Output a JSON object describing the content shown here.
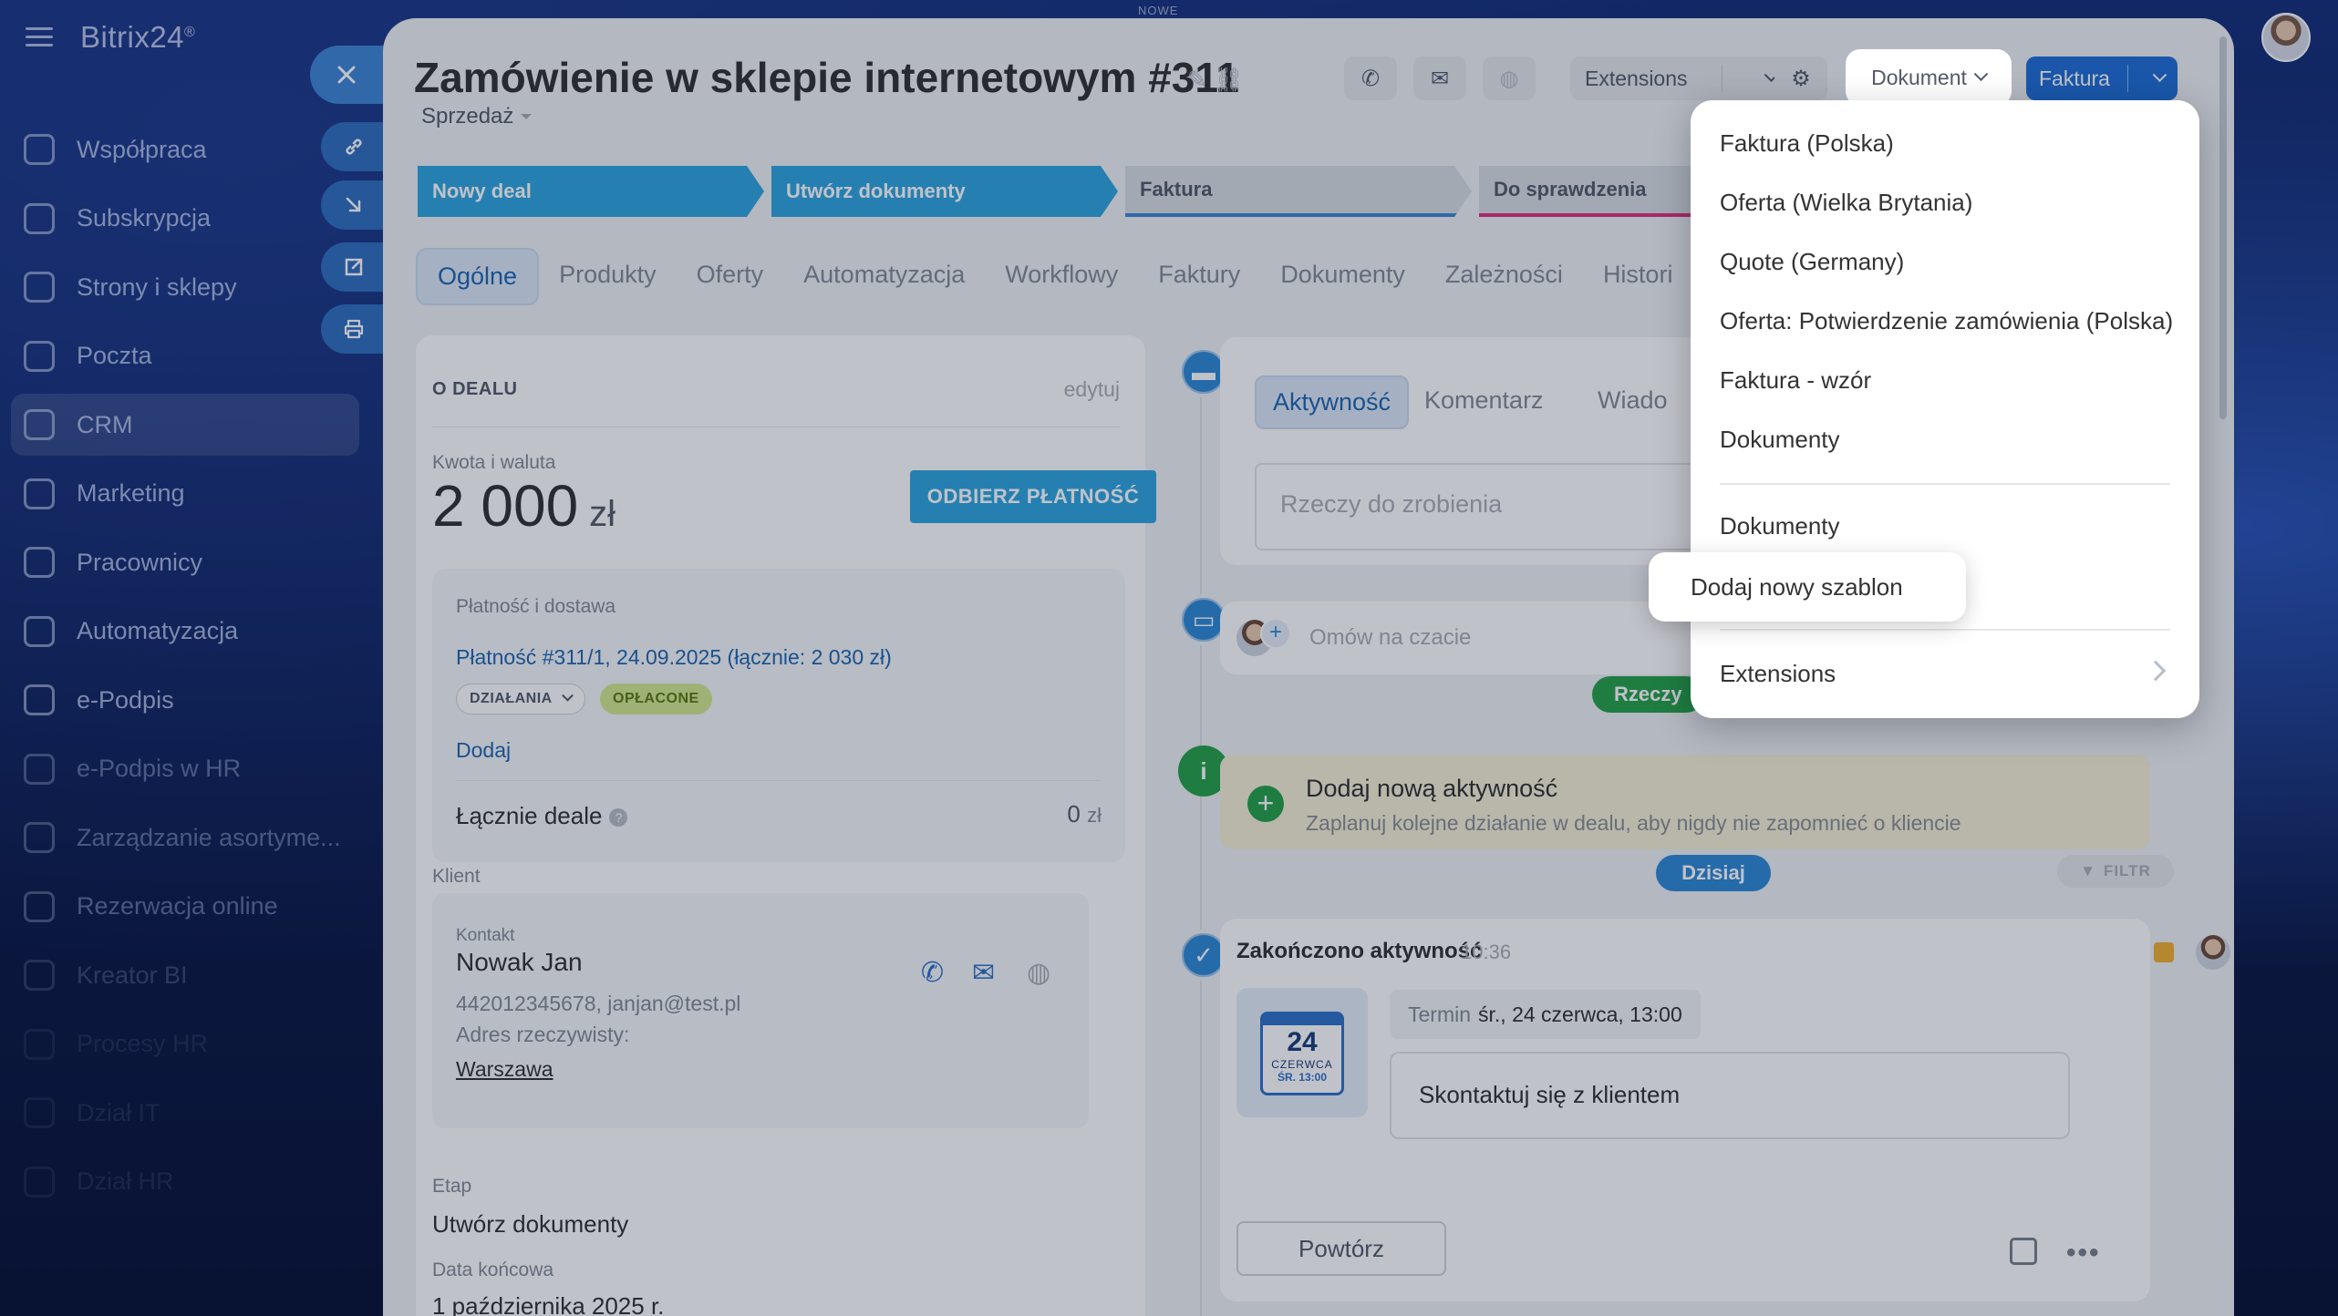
{
  "app": {
    "brand": "Bitrix24",
    "brand_mark": "®",
    "top_tag": "NOWE"
  },
  "sidebar": {
    "items": [
      {
        "label": "Współpraca",
        "icon": "chat-icon"
      },
      {
        "label": "Subskrypcja",
        "icon": "subscription-icon"
      },
      {
        "label": "Strony i sklepy",
        "icon": "cart-icon"
      },
      {
        "label": "Poczta",
        "icon": "mail-icon"
      },
      {
        "label": "CRM",
        "icon": "crm-icon",
        "active": true
      },
      {
        "label": "Marketing",
        "icon": "marketing-icon"
      },
      {
        "label": "Pracownicy",
        "icon": "employees-icon"
      },
      {
        "label": "Automatyzacja",
        "icon": "automation-icon"
      },
      {
        "label": "e-Podpis",
        "icon": "signature-icon"
      },
      {
        "label": "e-Podpis w HR",
        "icon": "hr-signature-icon"
      },
      {
        "label": "Zarządzanie asortyme...",
        "icon": "inventory-icon"
      },
      {
        "label": "Rezerwacja online",
        "icon": "booking-icon"
      },
      {
        "label": "Kreator BI",
        "icon": "bi-icon"
      },
      {
        "label": "Procesy HR",
        "icon": "hr-process-icon"
      },
      {
        "label": "Dział IT",
        "icon": "it-icon"
      },
      {
        "label": "Dział HR",
        "icon": "hr-icon"
      }
    ]
  },
  "header": {
    "title": "Zamówienie w sklepie internetowym #311",
    "pipeline": "Sprzedaż",
    "extensions_label": "Extensions",
    "document_label": "Dokument",
    "invoice_label": "Faktura"
  },
  "stages": [
    {
      "label": "Nowy deal",
      "state": "done"
    },
    {
      "label": "Utwórz dokumenty",
      "state": "done"
    },
    {
      "label": "Faktura",
      "state": "todo"
    },
    {
      "label": "Do sprawdzenia",
      "state": "todo"
    }
  ],
  "tabs": [
    "Ogólne",
    "Produkty",
    "Oferty",
    "Automatyzacja",
    "Workflowy",
    "Faktury",
    "Dokumenty",
    "Zależności",
    "Histori"
  ],
  "deal": {
    "section_title": "O DEALU",
    "edit": "edytuj",
    "amount_label": "Kwota i waluta",
    "amount": "2 000",
    "currency": "zł",
    "pay_button": "ODBIERZ PŁATNOŚĆ",
    "payment_section": "Płatność i dostawa",
    "payment_link": "Płatność #311/1, 24.09.2025 (łącznie: 2 030 zł)",
    "actions_chip": "DZIAŁANIA",
    "paid_chip": "OPŁACONE",
    "add_link": "Dodaj",
    "total_deals_label": "Łącznie deale",
    "total_deals_value": "0",
    "total_deals_currency": "zł",
    "client_label": "Klient",
    "contact_label": "Kontakt",
    "contact_name": "Nowak Jan",
    "contact_details": "442012345678, janjan@test.pl",
    "address_label": "Adres rzeczywisty:",
    "address_city": "Warszawa",
    "stage_label": "Etap",
    "stage_value": "Utwórz dokumenty",
    "end_date_label": "Data końcowa",
    "end_date_value": "1 października 2025 r."
  },
  "activity": {
    "tabs": [
      "Aktywność",
      "Komentarz",
      "Wiado"
    ],
    "todo_placeholder": "Rzeczy do zrobienia",
    "chat_placeholder": "Omów na czacie",
    "todo_pill": "Rzeczy",
    "hint_title": "Dodaj nową aktywność",
    "hint_subtitle": "Zaplanuj kolejne działanie w dealu, aby nigdy nie zapomnieć o kliencie",
    "today": "Dzisiaj",
    "filter": "FILTR",
    "done_title": "Zakończono aktywność",
    "done_time": "10:36",
    "calendar_day": "24",
    "calendar_month": "CZERWCA",
    "calendar_weekday": "ŚR. 13:00",
    "term_label": "Termin",
    "term_value": "śr., 24 czerwca, 13:00",
    "task_text": "Skontaktuj się z klientem",
    "repeat_button": "Powtórz"
  },
  "dropdown": {
    "group1": [
      "Faktura (Polska)",
      "Oferta (Wielka Brytania)",
      "Quote (Germany)",
      "Oferta: Potwierdzenie zamówienia (Polska)",
      "Faktura - wzór",
      "Dokumenty"
    ],
    "group2": [
      "Dokumenty",
      "Dodaj nowy szablon"
    ],
    "extensions": "Extensions"
  },
  "colors": {
    "accent": "#2fa7df",
    "primary_button": "#1f6fd6",
    "success": "#27a24a",
    "paid": "#d3ea8f"
  }
}
